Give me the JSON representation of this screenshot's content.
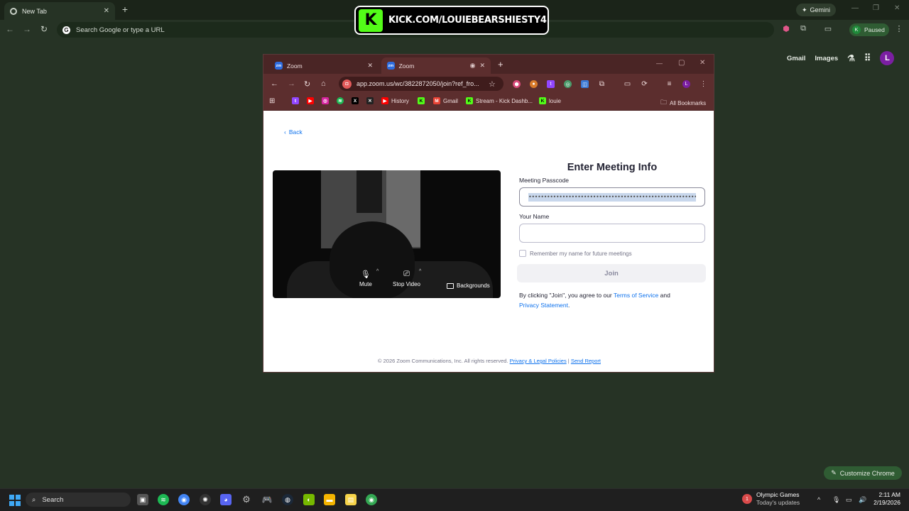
{
  "outer_browser": {
    "tab_title": "New Tab",
    "omnibox_placeholder": "Search Google or type a URL",
    "gemini_label": "Gemini",
    "profile_status": "Paused",
    "profile_initial": "K",
    "ntp_links": [
      "Gmail",
      "Images"
    ],
    "ntp_avatar_initial": "L",
    "customize_label": "Customize Chrome"
  },
  "overlay": {
    "kick_logo": "K",
    "kick_text": "KICK.COM/LOUIEBEARSHIESTY4"
  },
  "inner_browser": {
    "tabs": [
      {
        "title": "Zoom"
      },
      {
        "title": "Zoom"
      }
    ],
    "url": "app.zoom.us/wc/3822872050/join?ref_fro...",
    "profile_initial": "L",
    "bookmarks": [
      "History",
      "Gmail",
      "Stream - Kick Dashb...",
      "louie"
    ],
    "all_bookmarks": "All Bookmarks"
  },
  "zoom_page": {
    "back_label": "Back",
    "title": "Enter Meeting Info",
    "passcode_label": "Meeting Passcode",
    "passcode_masked": "••••••••••••••••••••••••••••••••••••••••••••••••••••••••••••••••••••••••••••••••",
    "name_label": "Your Name",
    "name_value": "",
    "remember_label": "Remember my name for future meetings",
    "join_label": "Join",
    "terms_prefix": "By clicking \"Join\", you agree to our ",
    "terms_link": "Terms of Service",
    "terms_mid": " and",
    "privacy_link": "Privacy Statement",
    "terms_suffix": ".",
    "video_controls": {
      "mute": "Mute",
      "stop_video": "Stop Video",
      "backgrounds": "Backgrounds"
    },
    "footer_text": "© 2026 Zoom Communications, Inc. All rights reserved.",
    "footer_link1": "Privacy & Legal Policies",
    "footer_sep": "|",
    "footer_link2": "Send Report"
  },
  "taskbar": {
    "search_label": "Search",
    "news_title": "Olympic Games",
    "news_sub": "Today's updates",
    "news_badge": "1",
    "time": "2:11 AM",
    "date": "2/19/2026"
  },
  "colors": {
    "zoom_blue": "#0e72ed",
    "kick_green": "#53fc18",
    "inner_chrome": "#5c2e2e",
    "outer_bg": "#263325"
  }
}
